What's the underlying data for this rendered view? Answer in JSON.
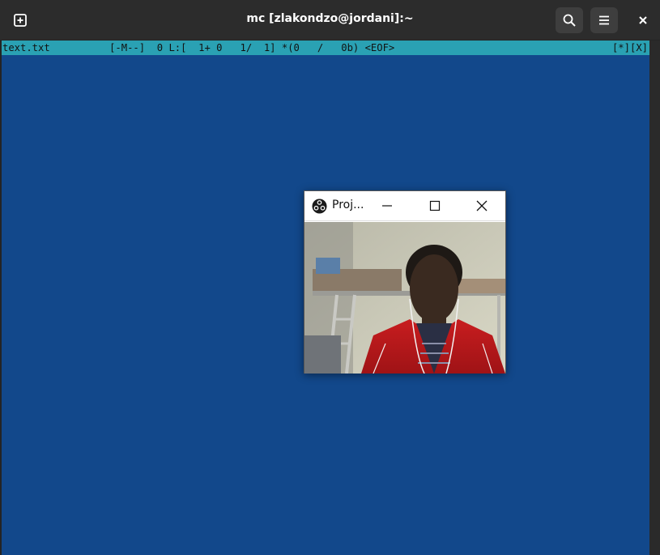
{
  "window": {
    "title": "mc [zlakondzo@jordani]:~",
    "buttons": {
      "new_tab_icon": "new-tab-icon",
      "search_icon": "search-icon",
      "menu_icon": "hamburger-menu-icon",
      "close_icon": "close-icon"
    }
  },
  "editor": {
    "status_line": "text.txt          [-M--]  0 L:[  1+ 0   1/  1] *(0   /   0b) <EOF>",
    "status_right": "[*][X]"
  },
  "projector": {
    "title": "Proj...",
    "icons": {
      "logo": "obs-logo-icon",
      "minimize": "minimize-icon",
      "maximize": "maximize-icon",
      "close": "close-icon"
    }
  },
  "colors": {
    "terminal_bg": "#12488b",
    "status_bar": "#2aa1b3",
    "header_bg": "#2c2c2c"
  }
}
